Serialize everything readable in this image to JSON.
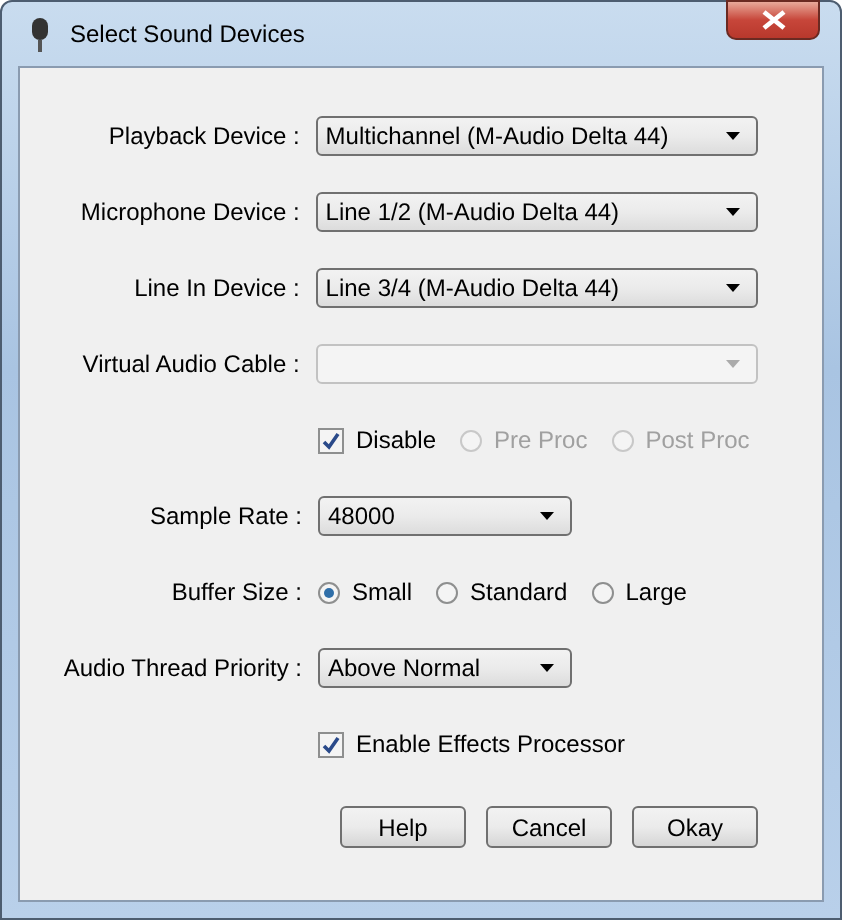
{
  "window": {
    "title": "Select Sound Devices"
  },
  "rows": [
    {
      "kind": "device",
      "label": "Playback Device :",
      "value": "Multichannel (M-Audio Delta 44)",
      "disabled": false
    },
    {
      "kind": "device",
      "label": "Microphone Device :",
      "value": "Line 1/2 (M-Audio Delta 44)",
      "disabled": false
    },
    {
      "kind": "device",
      "label": "Line In Device :",
      "value": "Line 3/4 (M-Audio Delta 44)",
      "disabled": false
    },
    {
      "kind": "device",
      "label": "Virtual Audio Cable :",
      "disabled": true
    },
    {
      "kind": "options",
      "options": [
        {
          "kind": "checkbox",
          "label": "Disable",
          "checked": true,
          "disabled": false
        },
        {
          "kind": "radio",
          "label": "Pre Proc",
          "selected": false,
          "disabled": true
        },
        {
          "kind": "radio",
          "label": "Post Proc",
          "selected": false,
          "disabled": true
        }
      ]
    },
    {
      "kind": "select",
      "label": "Sample Rate :",
      "value": "48000",
      "disabled": false
    },
    {
      "kind": "radios",
      "label": "Buffer Size :",
      "options": [
        {
          "label": "Small",
          "selected": true,
          "disabled": false
        },
        {
          "label": "Standard",
          "selected": false,
          "disabled": false
        },
        {
          "label": "Large",
          "selected": false,
          "disabled": false
        }
      ]
    },
    {
      "kind": "select",
      "label": "Audio Thread Priority :",
      "value": "Above Normal",
      "disabled": false
    },
    {
      "kind": "options",
      "options": [
        {
          "kind": "checkbox",
          "label": "Enable Effects Processor",
          "checked": true,
          "disabled": false
        }
      ]
    }
  ],
  "buttons": [
    "Help",
    "Cancel",
    "Okay"
  ]
}
